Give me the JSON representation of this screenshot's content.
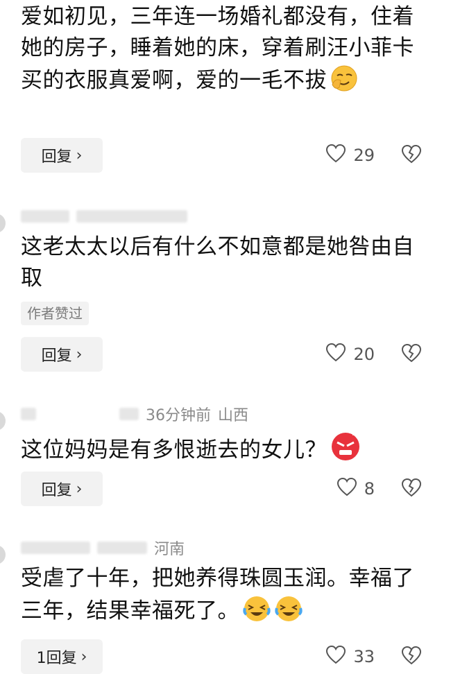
{
  "comments": [
    {
      "text": "爱如初见，三年连一场婚礼都没有，住着她的房子，睡着她的床，穿着刷汪小菲卡买的衣服真爱啊，爱的一毛不拔",
      "reply_label": "回复",
      "likes": "29",
      "emoji": "smirk-face-icon"
    },
    {
      "meta_time": "",
      "text": "这老太太以后有什么不如意都是她咎由自取",
      "badge": "作者赞过",
      "reply_label": "回复",
      "likes": "20"
    },
    {
      "meta_time": "36分钟前",
      "meta_location": "山西",
      "text": "这位妈妈是有多恨逝去的女儿？",
      "reply_label": "回复",
      "likes": "8",
      "emoji": "angry-face-icon"
    },
    {
      "meta_location": "河南",
      "text": "受虐了十年，把她养得珠圆玉润。幸福了三年，结果幸福死了。",
      "reply_label": "1回复",
      "likes": "33",
      "emoji": "laughing-crying-face-icon"
    }
  ]
}
